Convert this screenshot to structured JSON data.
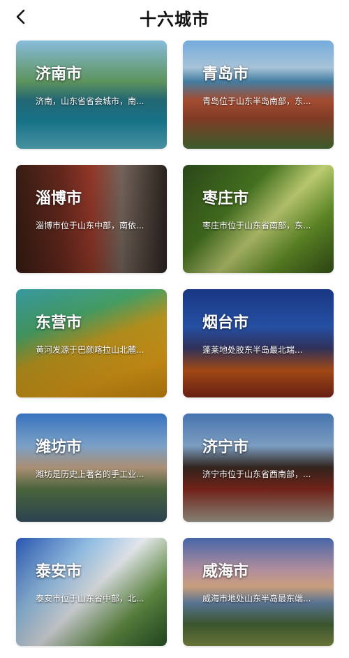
{
  "header": {
    "title": "十六城市"
  },
  "cities": [
    {
      "name": "济南市",
      "desc": "济南，山东省省会城市，南..."
    },
    {
      "name": "青岛市",
      "desc": "青岛位于山东半岛南部，东..."
    },
    {
      "name": "淄博市",
      "desc": "淄博市位于山东中部，南依..."
    },
    {
      "name": "枣庄市",
      "desc": "枣庄市位于山东省南部，东..."
    },
    {
      "name": "东营市",
      "desc": "黄河发源于巴颜喀拉山北麓..."
    },
    {
      "name": "烟台市",
      "desc": "蓬莱地处胶东半岛最北端..."
    },
    {
      "name": "潍坊市",
      "desc": "潍坊是历史上著名的手工业..."
    },
    {
      "name": "济宁市",
      "desc": "济宁市位于山东省西南部，..."
    },
    {
      "name": "泰安市",
      "desc": "泰安市位于山东省中部，北..."
    },
    {
      "name": "威海市",
      "desc": "威海市地处山东半岛最东端..."
    }
  ]
}
